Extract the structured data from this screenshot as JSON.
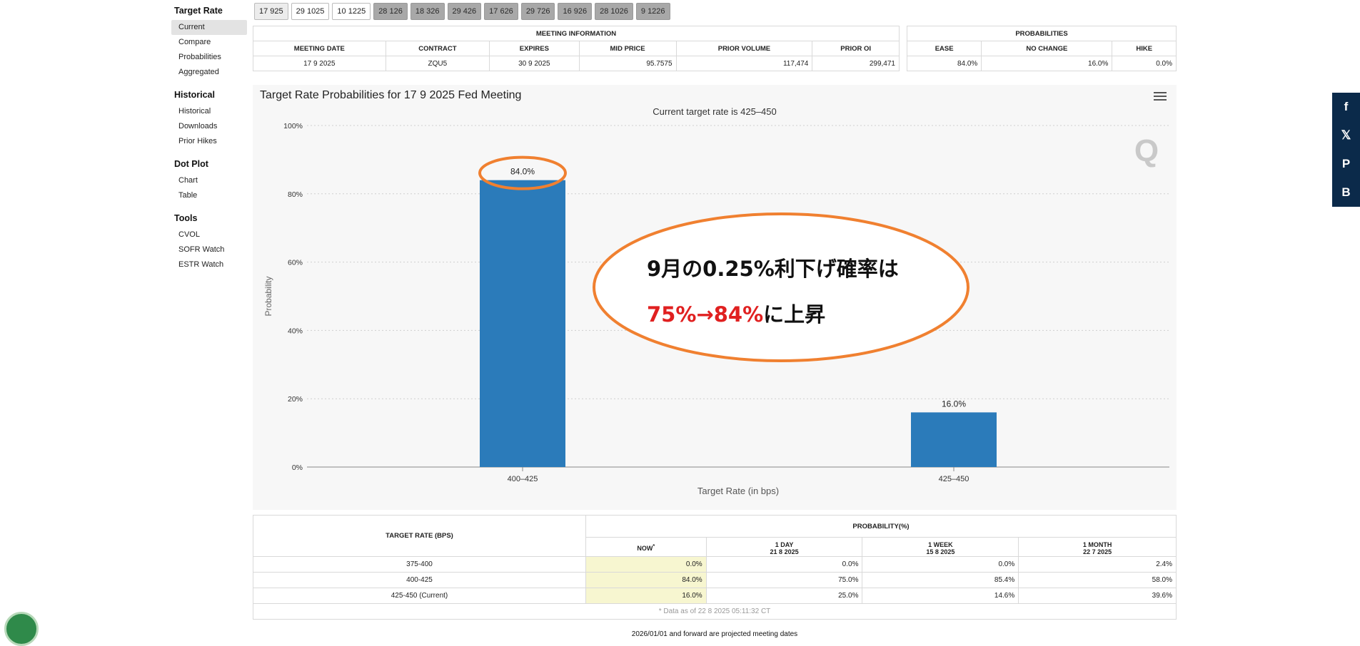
{
  "sidenav": {
    "sections": [
      {
        "title": "Target Rate",
        "items": [
          "Current",
          "Compare",
          "Probabilities",
          "Aggregated"
        ]
      },
      {
        "title": "Historical",
        "items": [
          "Historical",
          "Downloads",
          "Prior Hikes"
        ]
      },
      {
        "title": "Dot Plot",
        "items": [
          "Chart",
          "Table"
        ]
      },
      {
        "title": "Tools",
        "items": [
          "CVOL",
          "SOFR Watch",
          "ESTR Watch"
        ]
      }
    ]
  },
  "meeting_tabs": [
    "17 925",
    "29 1025",
    "10 1225",
    "28 126",
    "18 326",
    "29 426",
    "17 626",
    "29 726",
    "16 926",
    "28 1026",
    "9 1226"
  ],
  "meeting_info": {
    "title": "MEETING INFORMATION",
    "headers": [
      "MEETING DATE",
      "CONTRACT",
      "EXPIRES",
      "MID PRICE",
      "PRIOR VOLUME",
      "PRIOR OI"
    ],
    "row": [
      "17 9 2025",
      "ZQU5",
      "30 9 2025",
      "95.7575",
      "117,474",
      "299,471"
    ]
  },
  "probabilities": {
    "title": "PROBABILITIES",
    "headers": [
      "EASE",
      "NO CHANGE",
      "HIKE"
    ],
    "row": [
      "84.0%",
      "16.0%",
      "0.0%"
    ]
  },
  "chart_card": {
    "title": "Target Rate Probabilities for 17 9 2025 Fed Meeting"
  },
  "chart_data": {
    "type": "bar",
    "title": "Target Rate Probabilities for 17 9 2025 Fed Meeting",
    "subtitle": "Current target rate is 425–450",
    "xlabel": "Target Rate (in bps)",
    "ylabel": "Probability",
    "categories": [
      "400–425",
      "425–450"
    ],
    "values": [
      84.0,
      16.0
    ],
    "data_labels": [
      "84.0%",
      "16.0%"
    ],
    "yticks": [
      "0%",
      "20%",
      "40%",
      "60%",
      "80%",
      "100%"
    ],
    "ylim": [
      0,
      100
    ],
    "grid": true,
    "bar_color": "#2b7bba",
    "watermark": "Q"
  },
  "annotation": {
    "line1": "9月の0.25%利下げ確率は",
    "line2_red": "75%→84%",
    "line2_black": "に上昇",
    "ellipse_color": "#f08030",
    "red_color": "#e02020"
  },
  "social": [
    "f",
    "𝕏",
    "P",
    "B"
  ],
  "bottom_table": {
    "rate_header": "TARGET RATE (BPS)",
    "prob_header": "PROBABILITY(%)",
    "cols": [
      {
        "label": "NOW",
        "sup": "*",
        "date": ""
      },
      {
        "label": "1 DAY",
        "sup": "",
        "date": "21 8 2025"
      },
      {
        "label": "1 WEEK",
        "sup": "",
        "date": "15 8 2025"
      },
      {
        "label": "1 MONTH",
        "sup": "",
        "date": "22 7 2025"
      }
    ],
    "rows": [
      {
        "rate": "375-400",
        "vals": [
          "0.0%",
          "0.0%",
          "0.0%",
          "2.4%"
        ]
      },
      {
        "rate": "400-425",
        "vals": [
          "84.0%",
          "75.0%",
          "85.4%",
          "58.0%"
        ]
      },
      {
        "rate": "425-450 (Current)",
        "vals": [
          "16.0%",
          "25.0%",
          "14.6%",
          "39.6%"
        ]
      }
    ],
    "footnote": "* Data as of 22 8 2025 05:11:32 CT"
  },
  "projected_note": "2026/01/01 and forward are projected meeting dates"
}
